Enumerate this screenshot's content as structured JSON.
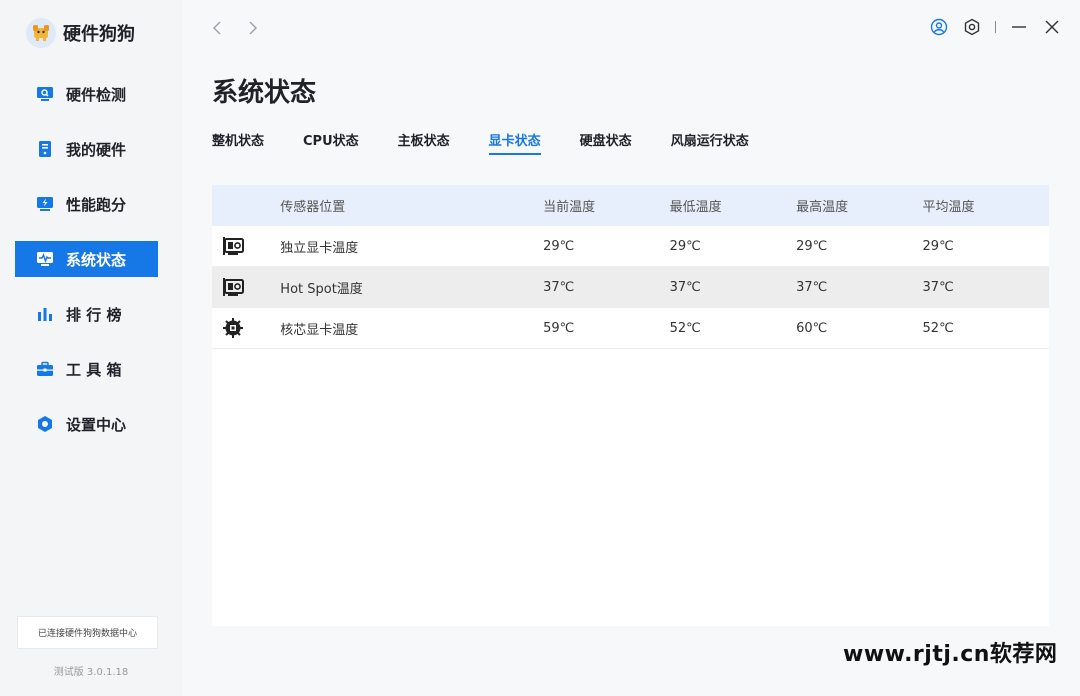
{
  "app": {
    "name": "硬件狗狗"
  },
  "sidebar": {
    "items": [
      {
        "label": "硬件检测"
      },
      {
        "label": "我的硬件"
      },
      {
        "label": "性能跑分"
      },
      {
        "label": "系统状态"
      },
      {
        "label": "排 行 榜"
      },
      {
        "label": "工 具 箱"
      },
      {
        "label": "设置中心"
      }
    ],
    "connection": "已连接硬件狗狗数据中心",
    "version": "测试版 3.0.1.18"
  },
  "page": {
    "title": "系统状态"
  },
  "tabs": [
    "整机状态",
    "CPU状态",
    "主板状态",
    "显卡状态",
    "硬盘状态",
    "风扇运行状态"
  ],
  "active_tab": "显卡状态",
  "table": {
    "headers": [
      "传感器位置",
      "当前温度",
      "最低温度",
      "最高温度",
      "平均温度"
    ],
    "rows": [
      {
        "icon": "gpu-card-icon",
        "name": "独立显卡温度",
        "cur": "29℃",
        "min": "29℃",
        "max": "29℃",
        "avg": "29℃"
      },
      {
        "icon": "gpu-card-icon",
        "name": "Hot Spot温度",
        "cur": "37℃",
        "min": "37℃",
        "max": "37℃",
        "avg": "37℃"
      },
      {
        "icon": "chip-icon",
        "name": "核芯显卡温度",
        "cur": "59℃",
        "min": "52℃",
        "max": "60℃",
        "avg": "52℃"
      }
    ]
  },
  "watermark": "www.rjtj.cn软荐网",
  "colors": {
    "accent": "#1677e6",
    "table_header": "#e6effb",
    "sidebar_bg": "#f4f5f7"
  }
}
